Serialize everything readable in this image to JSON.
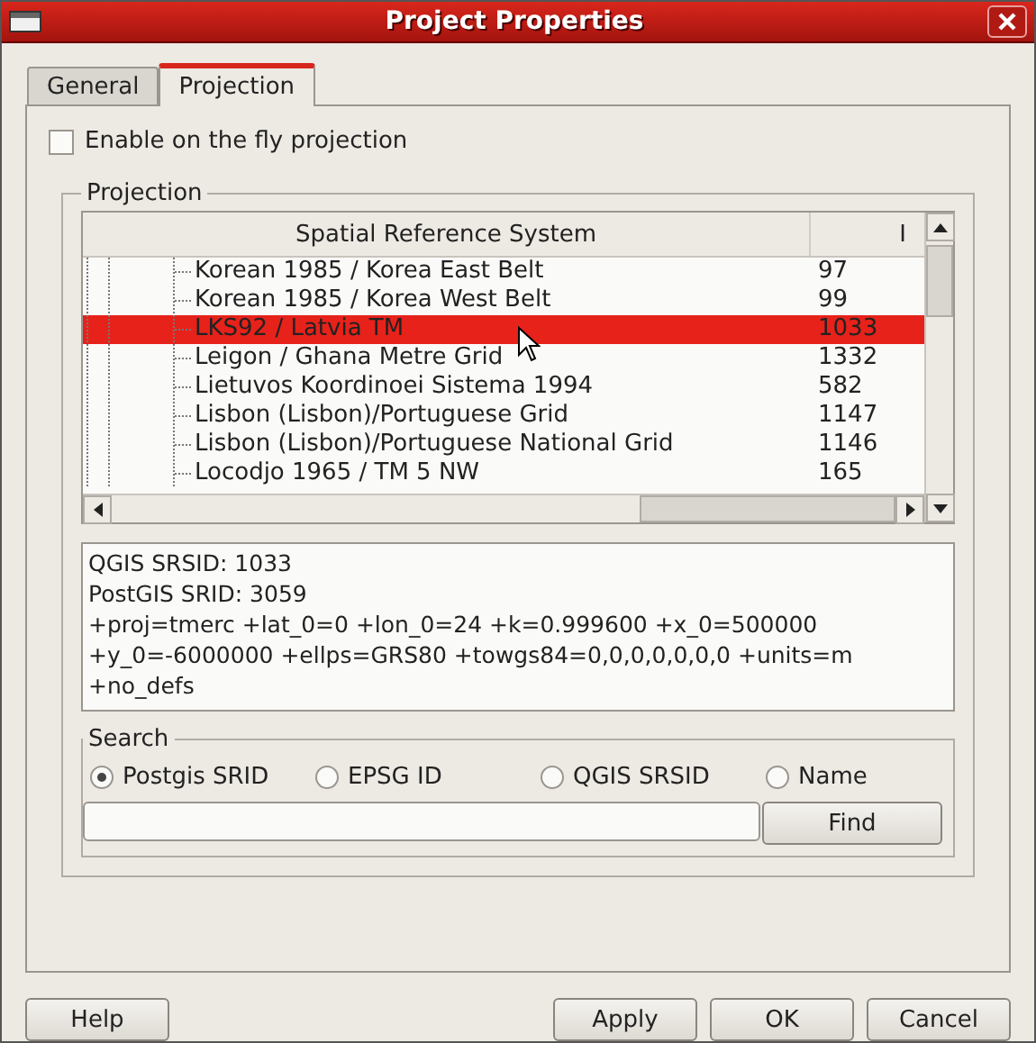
{
  "window": {
    "title": "Project Properties"
  },
  "tabs": [
    {
      "label": "General",
      "selected": false
    },
    {
      "label": "Projection",
      "selected": true
    }
  ],
  "on_the_fly": {
    "label": "Enable on the fly projection",
    "checked": false
  },
  "projection_group": {
    "title": "Projection",
    "table": {
      "columns": [
        "Spatial Reference System",
        "I"
      ],
      "rows": [
        {
          "name": "Korean 1985 / Korea East Belt",
          "id": "97",
          "selected": false
        },
        {
          "name": "Korean 1985 / Korea West Belt",
          "id": "99",
          "selected": false
        },
        {
          "name": "LKS92 / Latvia TM",
          "id": "1033",
          "selected": true
        },
        {
          "name": "Leigon / Ghana Metre Grid",
          "id": "1332",
          "selected": false
        },
        {
          "name": "Lietuvos Koordinoei Sistema 1994",
          "id": "582",
          "selected": false
        },
        {
          "name": "Lisbon (Lisbon)/Portuguese Grid",
          "id": "1147",
          "selected": false
        },
        {
          "name": "Lisbon (Lisbon)/Portuguese National Grid",
          "id": "1146",
          "selected": false
        },
        {
          "name": "Locodjo 1965 / TM 5 NW",
          "id": "165",
          "selected": false
        }
      ]
    },
    "details": [
      "QGIS SRSID: 1033",
      "PostGIS SRID: 3059",
      "+proj=tmerc +lat_0=0 +lon_0=24 +k=0.999600 +x_0=500000",
      "+y_0=-6000000 +ellps=GRS80 +towgs84=0,0,0,0,0,0,0 +units=m",
      "+no_defs"
    ],
    "search": {
      "title": "Search",
      "options": [
        {
          "label": "Postgis SRID",
          "selected": true
        },
        {
          "label": "EPSG ID",
          "selected": false
        },
        {
          "label": "QGIS SRSID",
          "selected": false
        },
        {
          "label": "Name",
          "selected": false
        }
      ],
      "find_button": "Find"
    }
  },
  "buttons": {
    "help": "Help",
    "apply": "Apply",
    "ok": "OK",
    "cancel": "Cancel"
  }
}
